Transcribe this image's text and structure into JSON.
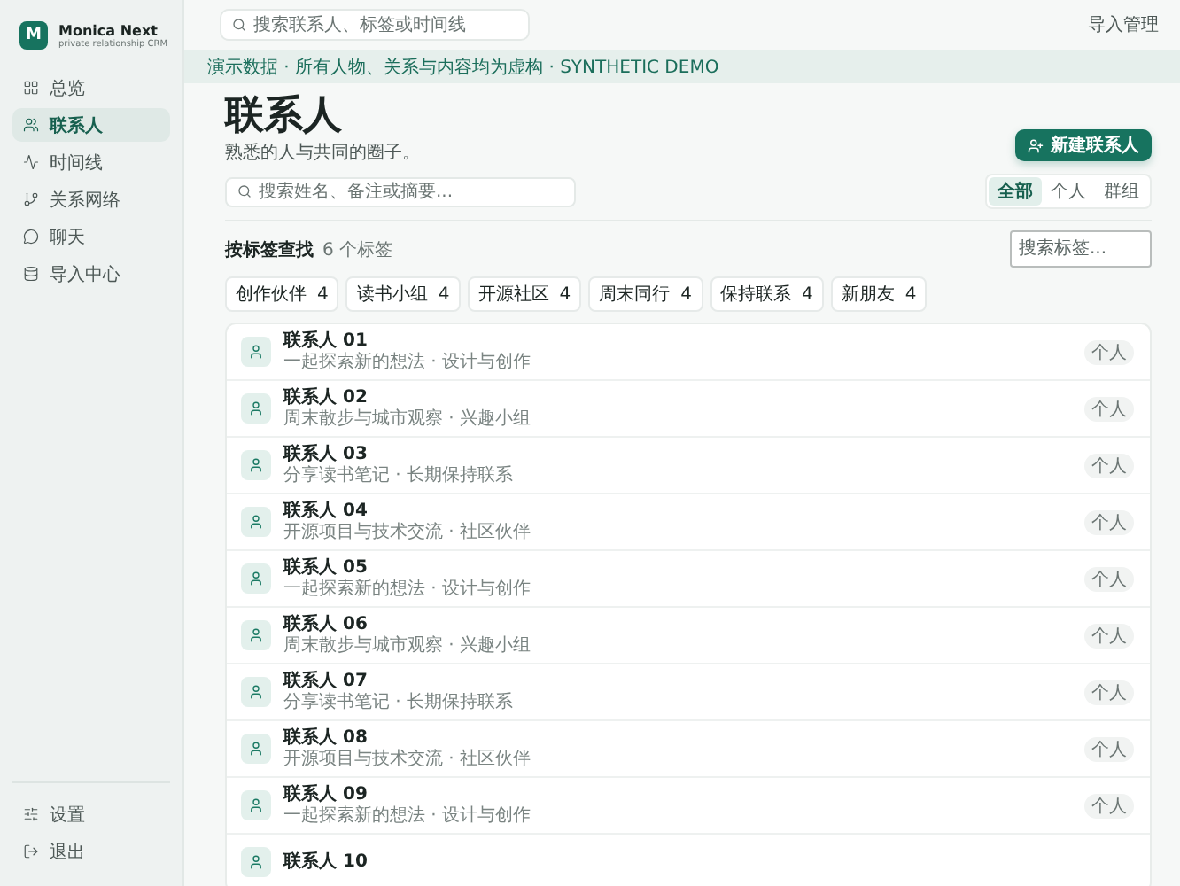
{
  "brand": {
    "logo": "M",
    "name": "Monica Next",
    "subtitle": "private relationship CRM"
  },
  "sidebar": {
    "items": [
      {
        "label": "总览",
        "kind": "grid",
        "selected": false
      },
      {
        "label": "联系人",
        "kind": "people",
        "selected": true
      },
      {
        "label": "时间线",
        "kind": "pulse",
        "selected": false
      },
      {
        "label": "关系网络",
        "kind": "branch",
        "selected": false
      },
      {
        "label": "聊天",
        "kind": "chat",
        "selected": false
      },
      {
        "label": "导入中心",
        "kind": "database",
        "selected": false
      }
    ],
    "footer_items": [
      {
        "label": "设置",
        "kind": "sliders"
      },
      {
        "label": "退出",
        "kind": "logout"
      }
    ]
  },
  "topbar": {
    "search_placeholder": "搜索联系人、标签或时间线",
    "link": "导入管理"
  },
  "banner": "演示数据 · 所有人物、关系与内容均为虚构 · SYNTHETIC DEMO",
  "header": {
    "title": "联系人",
    "subtitle": "熟悉的人与共同的圈子。",
    "new_button": "新建联系人",
    "search_placeholder": "搜索姓名、备注或摘要...",
    "segments": [
      {
        "label": "全部",
        "selected": true
      },
      {
        "label": "个人",
        "selected": false
      },
      {
        "label": "群组",
        "selected": false
      }
    ]
  },
  "tags_section": {
    "title": "按标签查找",
    "count": "6 个标签",
    "search_placeholder": "搜索标签...",
    "tags": [
      {
        "label": "创作伙伴",
        "count": "4"
      },
      {
        "label": "读书小组",
        "count": "4"
      },
      {
        "label": "开源社区",
        "count": "4"
      },
      {
        "label": "周末同行",
        "count": "4"
      },
      {
        "label": "保持联系",
        "count": "4"
      },
      {
        "label": "新朋友",
        "count": "4"
      }
    ]
  },
  "contacts": [
    {
      "name": "联系人 01",
      "note": "一起探索新的想法 · 设计与创作",
      "type": "个人"
    },
    {
      "name": "联系人 02",
      "note": "周末散步与城市观察 · 兴趣小组",
      "type": "个人"
    },
    {
      "name": "联系人 03",
      "note": "分享读书笔记 · 长期保持联系",
      "type": "个人"
    },
    {
      "name": "联系人 04",
      "note": "开源项目与技术交流 · 社区伙伴",
      "type": "个人"
    },
    {
      "name": "联系人 05",
      "note": "一起探索新的想法 · 设计与创作",
      "type": "个人"
    },
    {
      "name": "联系人 06",
      "note": "周末散步与城市观察 · 兴趣小组",
      "type": "个人"
    },
    {
      "name": "联系人 07",
      "note": "分享读书笔记 · 长期保持联系",
      "type": "个人"
    },
    {
      "name": "联系人 08",
      "note": "开源项目与技术交流 · 社区伙伴",
      "type": "个人"
    },
    {
      "name": "联系人 09",
      "note": "一起探索新的想法 · 设计与创作",
      "type": "个人"
    },
    {
      "name": "联系人 10"
    }
  ]
}
